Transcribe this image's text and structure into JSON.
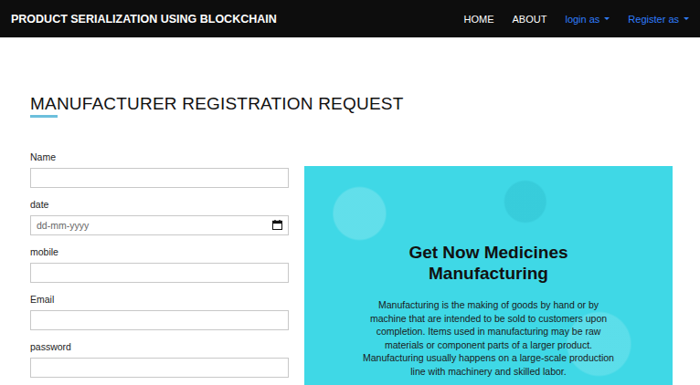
{
  "navbar": {
    "brand": "PRODUCT SERIALIZATION USING BLOCKCHAIN",
    "links": [
      {
        "label": "HOME",
        "dropdown": false
      },
      {
        "label": "ABOUT",
        "dropdown": false
      },
      {
        "label": "login as",
        "dropdown": true
      },
      {
        "label": "Register as",
        "dropdown": true
      }
    ]
  },
  "title": "MANUFACTURER REGISTRATION REQUEST",
  "form": {
    "fields": [
      {
        "label": "Name",
        "kind": "text",
        "placeholder": ""
      },
      {
        "label": "date",
        "kind": "date",
        "placeholder": "dd-mm-yyyy"
      },
      {
        "label": "mobile",
        "kind": "text",
        "placeholder": ""
      },
      {
        "label": "Email",
        "kind": "text",
        "placeholder": ""
      },
      {
        "label": "password",
        "kind": "password",
        "placeholder": ""
      }
    ]
  },
  "panel": {
    "heading": "Get Now Medicines Manufacturing",
    "text": "Manufacturing is the making of goods by hand or by machine that are intended to be sold to customers upon completion. Items used in manufacturing may be raw materials or component parts of a larger product. Manufacturing usually happens on a large-scale production line with machinery and skilled labor."
  }
}
